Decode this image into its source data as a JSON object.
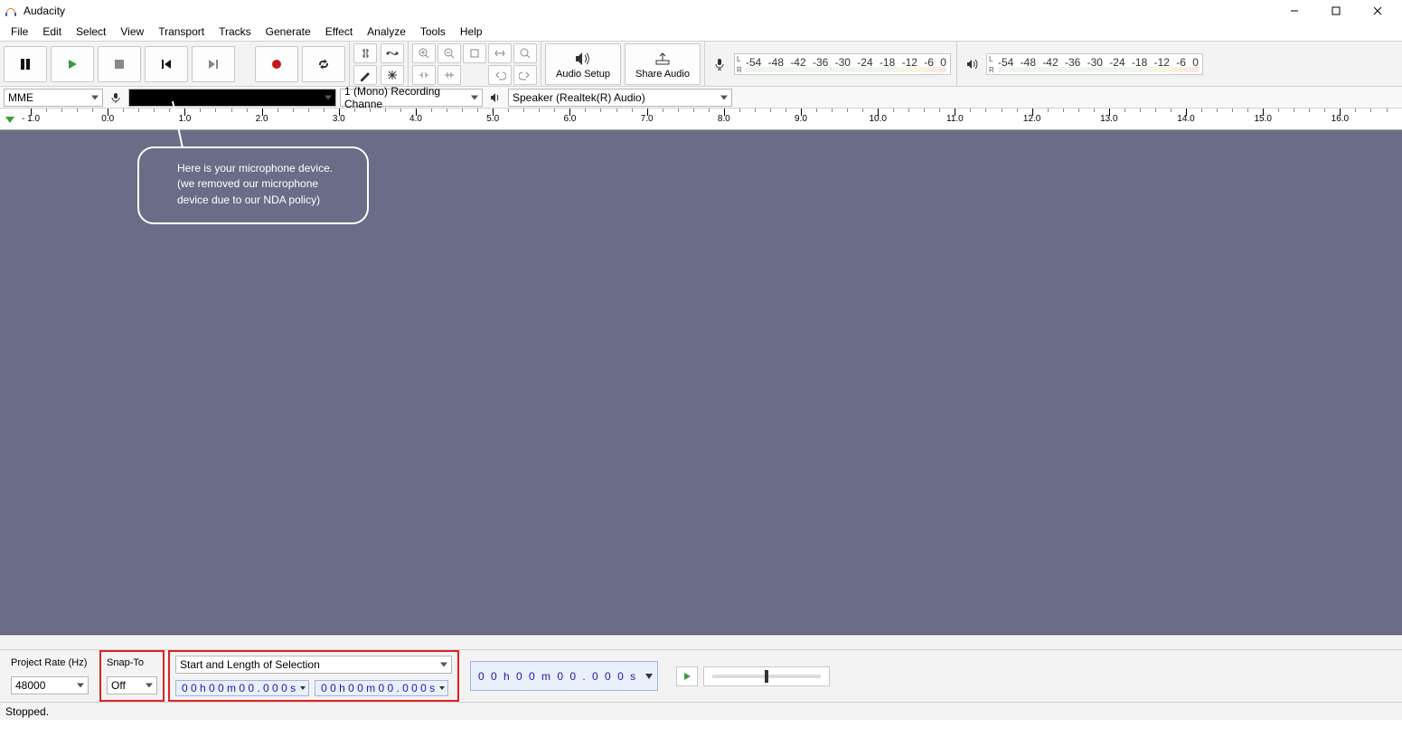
{
  "title": "Audacity",
  "menu": [
    "File",
    "Edit",
    "Select",
    "View",
    "Transport",
    "Tracks",
    "Generate",
    "Effect",
    "Analyze",
    "Tools",
    "Help"
  ],
  "transport": {
    "pause": "Pause",
    "play": "Play",
    "stop": "Stop",
    "skip_start": "Skip to Start",
    "skip_end": "Skip to End",
    "record": "Record",
    "loop": "Loop"
  },
  "audio_setup": {
    "label": "Audio Setup"
  },
  "share_audio": {
    "label": "Share Audio"
  },
  "meter_ticks": [
    "-54",
    "-48",
    "-42",
    "-36",
    "-30",
    "-24",
    "-18",
    "-12",
    "-6",
    "0"
  ],
  "device": {
    "host": "MME",
    "input_device": "",
    "input_channels": "1 (Mono) Recording Channe",
    "output_device": "Speaker (Realtek(R) Audio)"
  },
  "ruler": {
    "start": -1.0,
    "end": 16.0,
    "labels": [
      "1.0",
      "0.0",
      "1.0",
      "2.0",
      "3.0",
      "4.0",
      "5.0",
      "6.0",
      "7.0",
      "8.0",
      "9.0",
      "10.0",
      "11.0",
      "12.0",
      "13.0",
      "14.0",
      "15.0",
      "16.0"
    ],
    "neg_first": true
  },
  "annotation": {
    "line1": "Here is your microphone device.",
    "line2": "(we removed our microphone device due to our NDA policy)"
  },
  "bottom": {
    "project_rate_label": "Project Rate (Hz)",
    "project_rate_value": "48000",
    "snap_to_label": "Snap-To",
    "snap_to_value": "Off",
    "selection_mode": "Start and Length of Selection",
    "selection_start": "0 0 h 0 0 m 0 0 . 0 0 0 s",
    "selection_length": "0 0 h 0 0 m 0 0 . 0 0 0 s",
    "position": "0 0 h 0 0 m 0 0 . 0 0 0 s"
  },
  "status": "Stopped."
}
